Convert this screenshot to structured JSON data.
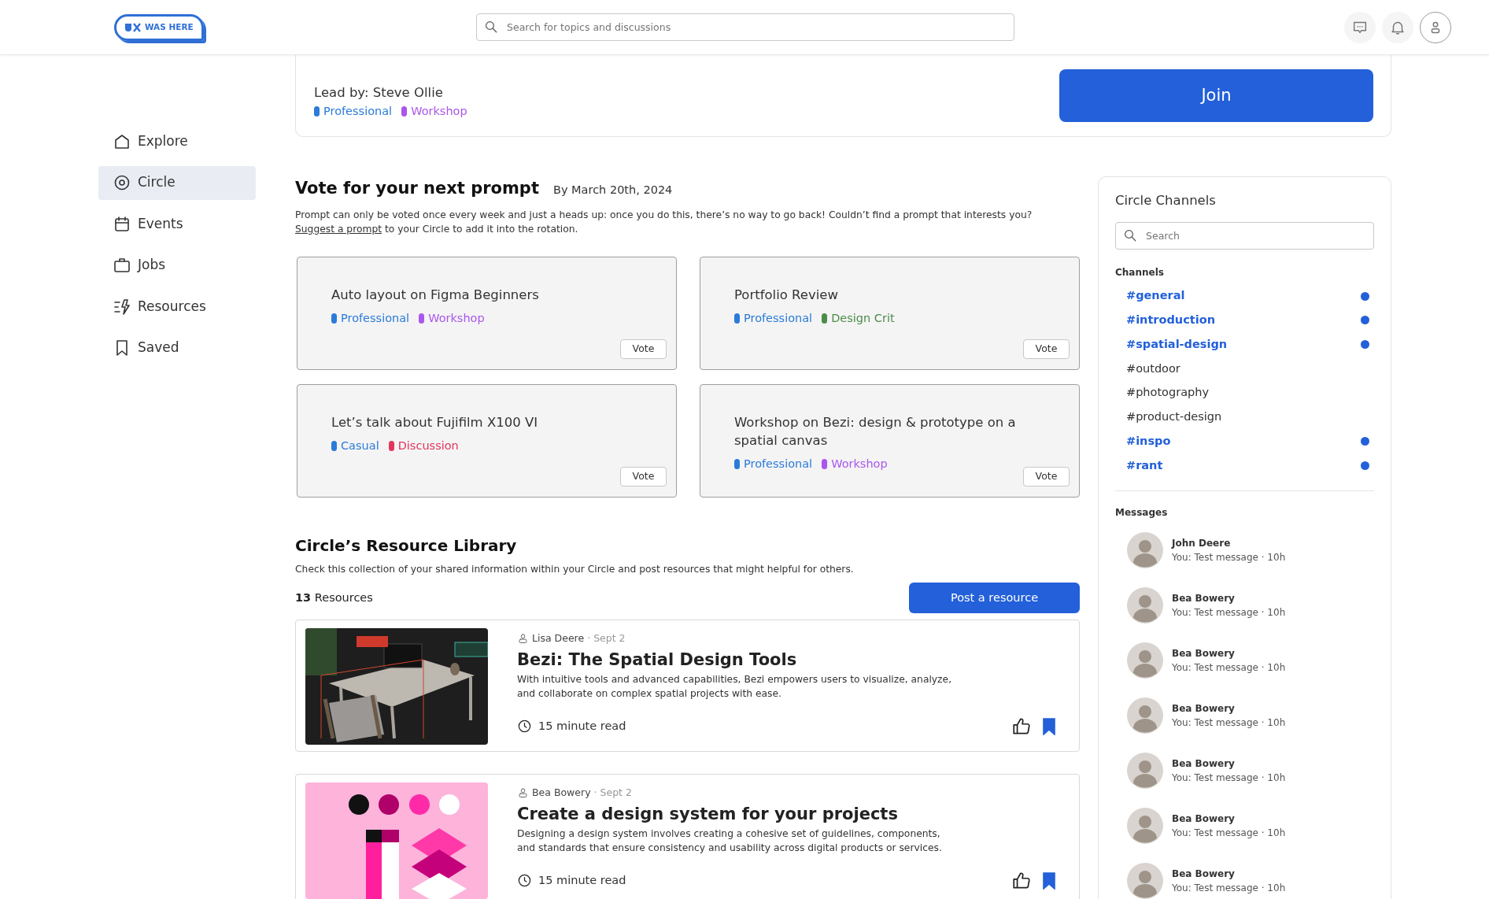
{
  "header": {
    "logo_text": "WAS HERE",
    "search": {
      "placeholder": "Search for topics and discussions"
    }
  },
  "sidebar": {
    "items": [
      {
        "label": "Explore",
        "selected": false
      },
      {
        "label": "Circle",
        "selected": true
      },
      {
        "label": "Events",
        "selected": false
      },
      {
        "label": "Jobs",
        "selected": false
      },
      {
        "label": "Resources",
        "selected": false
      },
      {
        "label": "Saved",
        "selected": false
      }
    ]
  },
  "circle": {
    "lead": "Lead by: Steve Ollie",
    "tags": [
      {
        "label": "Professional",
        "color": "#2b7bd8"
      },
      {
        "label": "Workshop",
        "color": "#a957ec"
      }
    ],
    "join_button": "Join"
  },
  "vote": {
    "title": "Vote for your next prompt",
    "deadline": "By March 20th, 2024",
    "description": "Prompt can only be voted once every week and just a heads up: once you do this, there’s no way to go back! Couldn’t find a prompt that interests you?",
    "link": "Suggest a prompt",
    "description_end": "to your Circle to add it into the rotation.",
    "prompts": [
      {
        "title": "Auto layout on Figma Beginners",
        "tags": [
          {
            "label": "Professional",
            "color": "#2b7bd8"
          },
          {
            "label": "Workshop",
            "color": "#a957ec"
          }
        ],
        "button": "Vote"
      },
      {
        "title": "Portfolio Review",
        "tags": [
          {
            "label": "Professional",
            "color": "#2b7bd8"
          },
          {
            "label": "Design Crit",
            "color": "#4c8c4a"
          }
        ],
        "button": "Vote"
      },
      {
        "title": "Let’s talk about Fujifilm X100 VI",
        "tags": [
          {
            "label": "Casual",
            "color": "#2b7bd8"
          },
          {
            "label": "Discussion",
            "color": "#e3345c"
          }
        ],
        "button": "Vote"
      },
      {
        "title": "Workshop on Bezi: design & prototype on a spatial canvas",
        "tags": [
          {
            "label": "Professional",
            "color": "#2b7bd8"
          },
          {
            "label": "Workshop",
            "color": "#a957ec"
          }
        ],
        "button": "Vote"
      }
    ]
  },
  "library": {
    "title": "Circle’s Resource Library",
    "description": "Check this collection of your shared information within your Circle and post resources that might helpful for others.",
    "count": "13",
    "count_label": "Resources",
    "post_button": "Post a resource",
    "resources": [
      {
        "kind": "picture",
        "author": "Lisa Deere",
        "separator": "·",
        "date": "Sept 2",
        "title": "Bezi: The Spatial Design Tools",
        "description": "With intuitive tools and advanced capabilities, Bezi empowers users to visualize, analyze, and collaborate on complex spatial projects with ease.",
        "read_time": "15 minute read",
        "saved": true
      },
      {
        "kind": "picture",
        "author": "Bea Bowery",
        "separator": "·",
        "date": "Sept 2",
        "title": "Create a design system for your projects",
        "description": "Designing a design system involves creating a cohesive set of guidelines, components, and standards that ensure consistency and usability across digital products or services.",
        "read_time": "15 minute read",
        "saved": true
      }
    ]
  },
  "channels_panel": {
    "title": "Circle Channels",
    "search": {
      "placeholder": "Search"
    },
    "channels_label": "Channels",
    "channels": [
      {
        "name": "#general",
        "unread": true
      },
      {
        "name": "#introduction",
        "unread": true
      },
      {
        "name": "#spatial-design",
        "unread": true
      },
      {
        "name": "#outdoor",
        "unread": false
      },
      {
        "name": "#photography",
        "unread": false
      },
      {
        "name": "#product-design",
        "unread": false
      },
      {
        "name": "#inspo",
        "unread": true
      },
      {
        "name": "#rant",
        "unread": true
      }
    ],
    "messages_label": "Messages",
    "messages": [
      {
        "name": "John Deere",
        "preview": "You: Test message · 10h"
      },
      {
        "name": "Bea Bowery",
        "preview": "You: Test message · 10h"
      },
      {
        "name": "Bea Bowery",
        "preview": "You: Test message · 10h"
      },
      {
        "name": "Bea Bowery",
        "preview": "You: Test message · 10h"
      },
      {
        "name": "Bea Bowery",
        "preview": "You: Test message · 10h"
      },
      {
        "name": "Bea Bowery",
        "preview": "You: Test message · 10h"
      },
      {
        "name": "Bea Bowery",
        "preview": "You: Test message · 10h"
      }
    ]
  }
}
